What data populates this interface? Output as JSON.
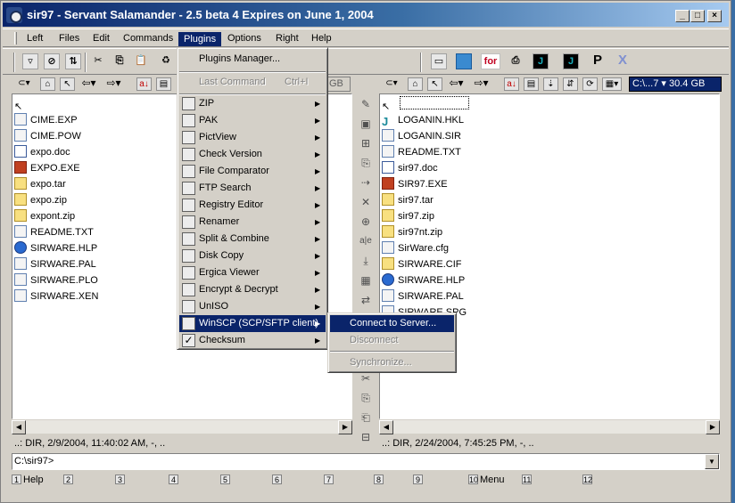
{
  "title": "sir97 - Servant Salamander - 2.5 beta 4 Expires on June 1, 2004",
  "window_buttons": {
    "minimize": "_",
    "maximize": "□",
    "close": "×"
  },
  "menubar": [
    "Left",
    "Files",
    "Edit",
    "Commands",
    "Plugins",
    "Options",
    "Right",
    "Help"
  ],
  "toolbar": {
    "for_label": "for",
    "j_label": "J",
    "p_label": "P",
    "x_label": "X"
  },
  "left_panel": {
    "up_label": "",
    "files": [
      {
        "name": "CIME.EXP",
        "icon": "file"
      },
      {
        "name": "CIME.POW",
        "icon": "file"
      },
      {
        "name": "expo.doc",
        "icon": "doc"
      },
      {
        "name": "EXPO.EXE",
        "icon": "exe"
      },
      {
        "name": "expo.tar",
        "icon": "folder"
      },
      {
        "name": "expo.zip",
        "icon": "folder"
      },
      {
        "name": "expont.zip",
        "icon": "folder"
      },
      {
        "name": "README.TXT",
        "icon": "file"
      },
      {
        "name": "SIRWARE.HLP",
        "icon": "help"
      },
      {
        "name": "SIRWARE.PAL",
        "icon": "file"
      },
      {
        "name": "SIRWARE.PLO",
        "icon": "file"
      },
      {
        "name": "SIRWARE.XEN",
        "icon": "file"
      }
    ],
    "drive_suffix": "GB",
    "status": "..: DIR, 2/9/2004, 11:40:02 AM, -, .."
  },
  "right_panel": {
    "drive": "C:\\...7 ▾ 30.4 GB",
    "files": [
      {
        "name": "LOGANIN.HKL",
        "icon": "j"
      },
      {
        "name": "LOGANIN.SIR",
        "icon": "file"
      },
      {
        "name": "README.TXT",
        "icon": "file"
      },
      {
        "name": "sir97.doc",
        "icon": "doc"
      },
      {
        "name": "SIR97.EXE",
        "icon": "exe"
      },
      {
        "name": "sir97.tar",
        "icon": "folder"
      },
      {
        "name": "sir97.zip",
        "icon": "folder"
      },
      {
        "name": "sir97nt.zip",
        "icon": "folder"
      },
      {
        "name": "SirWare.cfg",
        "icon": "file"
      },
      {
        "name": "SIRWARE.CIF",
        "icon": "folder"
      },
      {
        "name": "SIRWARE.HLP",
        "icon": "help"
      },
      {
        "name": "SIRWARE.PAL",
        "icon": "file"
      },
      {
        "name": "SIRWARE.SPG",
        "icon": "file"
      }
    ],
    "status": "..: DIR, 2/24/2004, 7:45:25 PM, -, .."
  },
  "command_line": "C:\\sir97>",
  "fkeys": [
    {
      "num": "1",
      "label": "Help"
    },
    {
      "num": "2",
      "label": ""
    },
    {
      "num": "3",
      "label": ""
    },
    {
      "num": "4",
      "label": ""
    },
    {
      "num": "5",
      "label": ""
    },
    {
      "num": "6",
      "label": ""
    },
    {
      "num": "7",
      "label": ""
    },
    {
      "num": "8",
      "label": ""
    },
    {
      "num": "9",
      "label": ""
    },
    {
      "num": "10",
      "label": "Menu"
    },
    {
      "num": "11",
      "label": ""
    },
    {
      "num": "12",
      "label": ""
    }
  ],
  "plugins_menu": {
    "manager": "Plugins Manager...",
    "last_command": "Last Command",
    "last_command_shortcut": "Ctrl+I",
    "items": [
      "ZIP",
      "PAK",
      "PictView",
      "Check Version",
      "File Comparator",
      "FTP Search",
      "Registry Editor",
      "Renamer",
      "Split & Combine",
      "Disk Copy",
      "Ergica Viewer",
      "Encrypt & Decrypt",
      "UnISO",
      "WinSCP (SCP/SFTP client)",
      "Checksum"
    ]
  },
  "winscp_submenu": {
    "connect": "Connect to Server...",
    "disconnect": "Disconnect",
    "synchronize": "Synchronize..."
  },
  "colors": {
    "highlight": "#0a246a",
    "face": "#d4d0c8",
    "desktop": "#3a6ea5"
  }
}
